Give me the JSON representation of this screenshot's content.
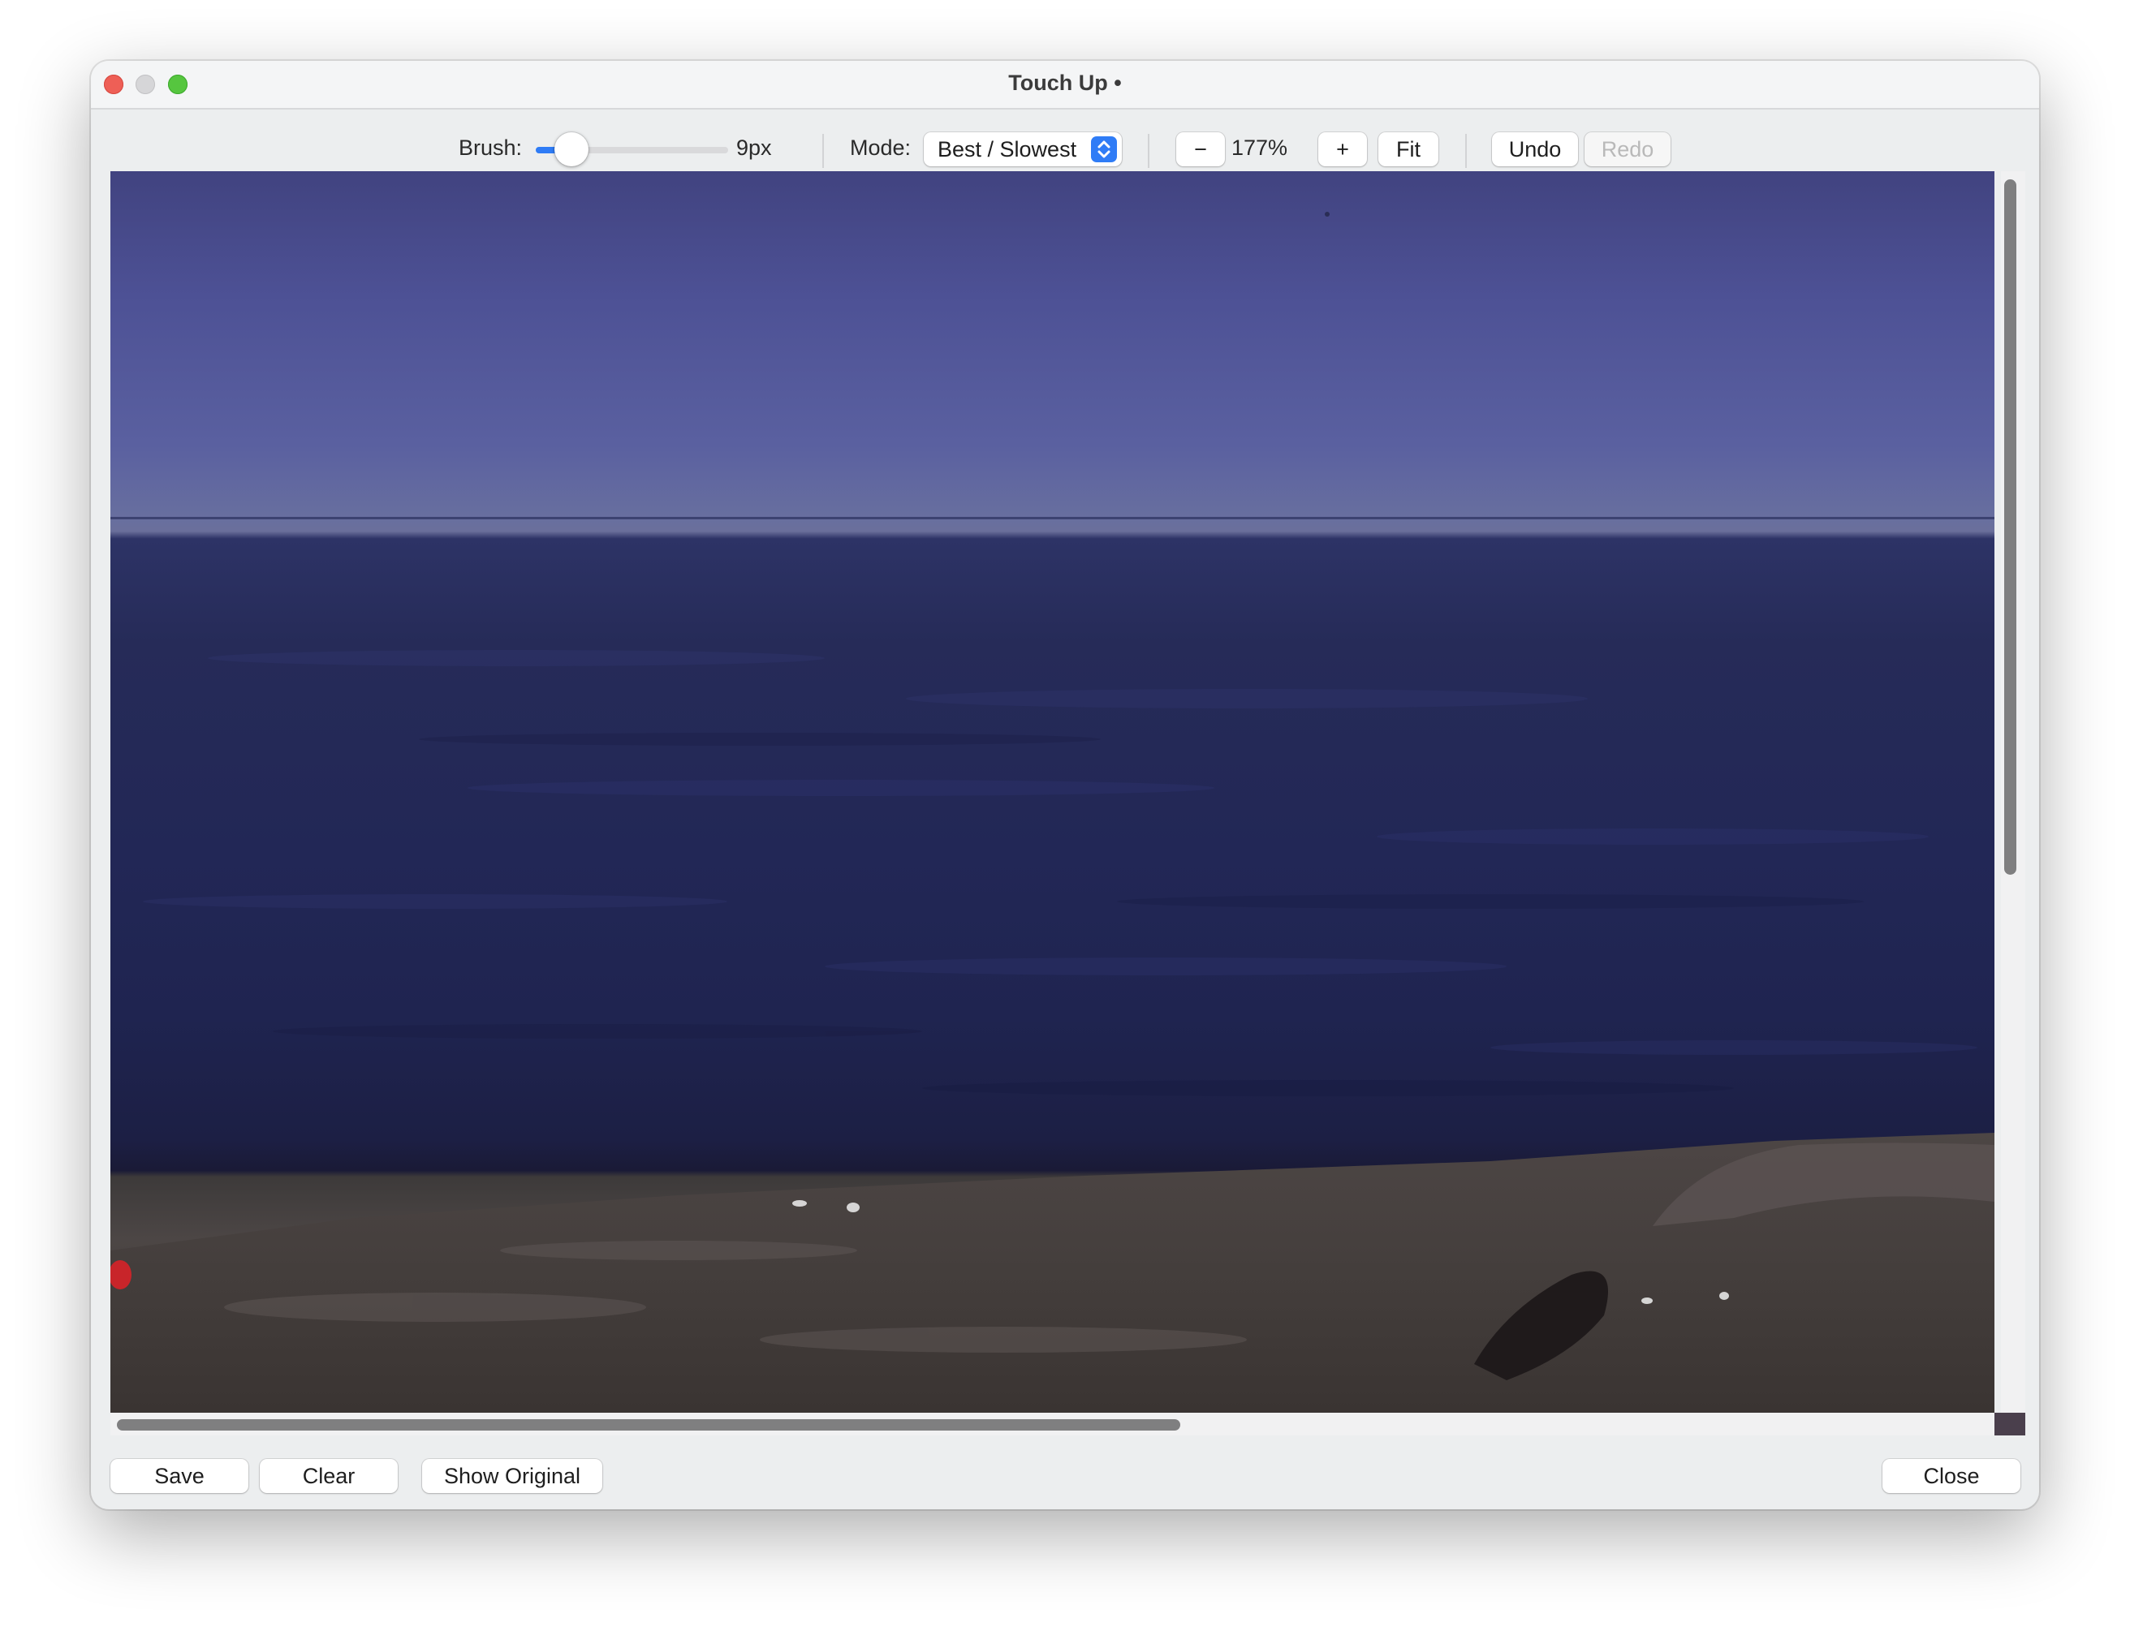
{
  "window": {
    "title": "Touch Up •"
  },
  "toolbar": {
    "brush_label": "Brush:",
    "brush_value": "9px",
    "brush_level": 0.12,
    "mode_label": "Mode:",
    "mode_selected": "Best / Slowest",
    "zoom_out_label": "−",
    "zoom_value": "177%",
    "zoom_in_label": "+",
    "fit_label": "Fit",
    "undo_label": "Undo",
    "redo_label": "Redo"
  },
  "bottom_bar": {
    "save_label": "Save",
    "clear_label": "Clear",
    "show_original_label": "Show Original",
    "close_label": "Close"
  },
  "icons": {
    "mode_select": "chevron-up-down-icon"
  },
  "colors": {
    "accent": "#2f7cf6",
    "close_dot": "#ee5f56",
    "maximize_dot": "#56c63f"
  }
}
